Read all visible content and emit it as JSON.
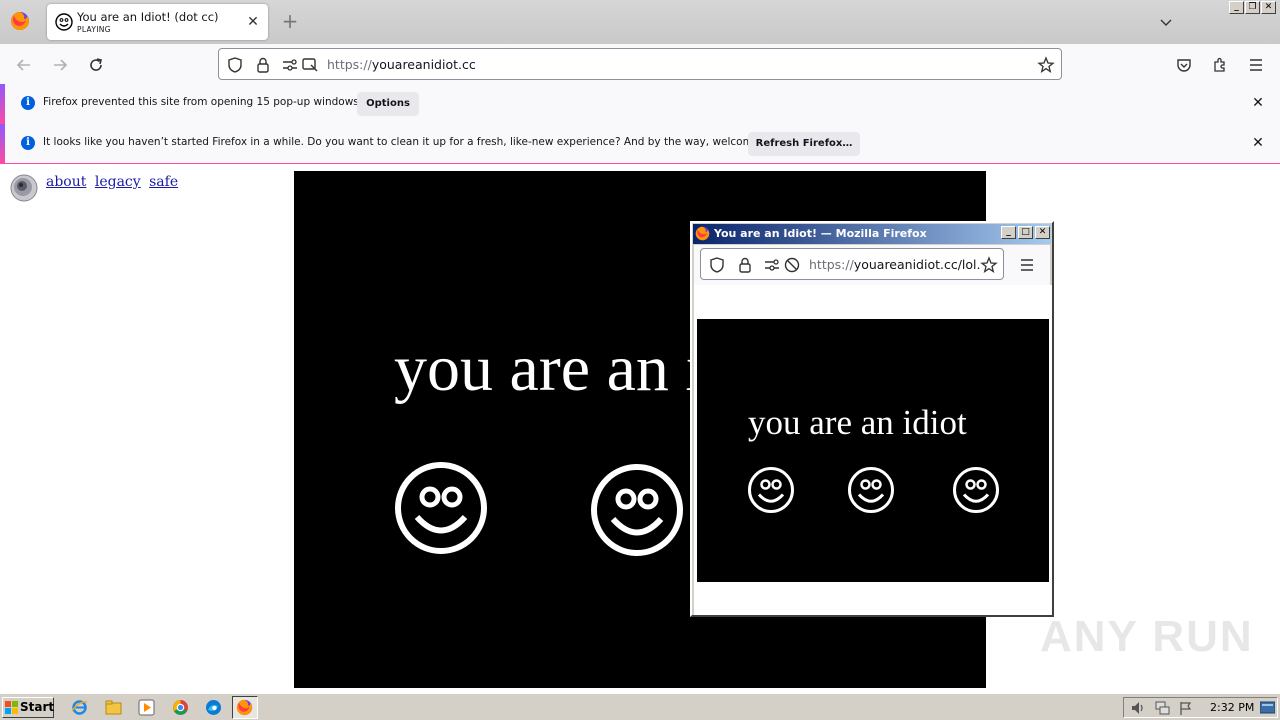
{
  "browser": {
    "tab": {
      "title": "You are an Idiot! (dot cc)",
      "subtitle": "PLAYING"
    },
    "url": {
      "scheme": "https://",
      "host": "youareanidiot.cc"
    }
  },
  "notifications": [
    {
      "text": "Firefox prevented this site from opening 15 pop-up windows.",
      "button": "Options"
    },
    {
      "text": "It looks like you haven’t started Firefox in a while. Do you want to clean it up for a fresh, like-new experience? And by the way, welcome back!",
      "button": "Refresh Firefox…"
    }
  ],
  "page": {
    "links": [
      "about",
      "legacy",
      "safe"
    ],
    "video_text": "you are an idiot"
  },
  "popup": {
    "title": "You are an Idiot! — Mozilla Firefox",
    "url": {
      "scheme": "https://",
      "host": "youareanidiot.cc/lol.h"
    },
    "video_text": "you are an idiot"
  },
  "watermark": "ANY RUN",
  "taskbar": {
    "start_label": "Start",
    "clock": "2:32 PM"
  },
  "colors": {
    "accent": "#0060df",
    "link": "#1a1aa6",
    "titlebar": "#0a246a"
  }
}
